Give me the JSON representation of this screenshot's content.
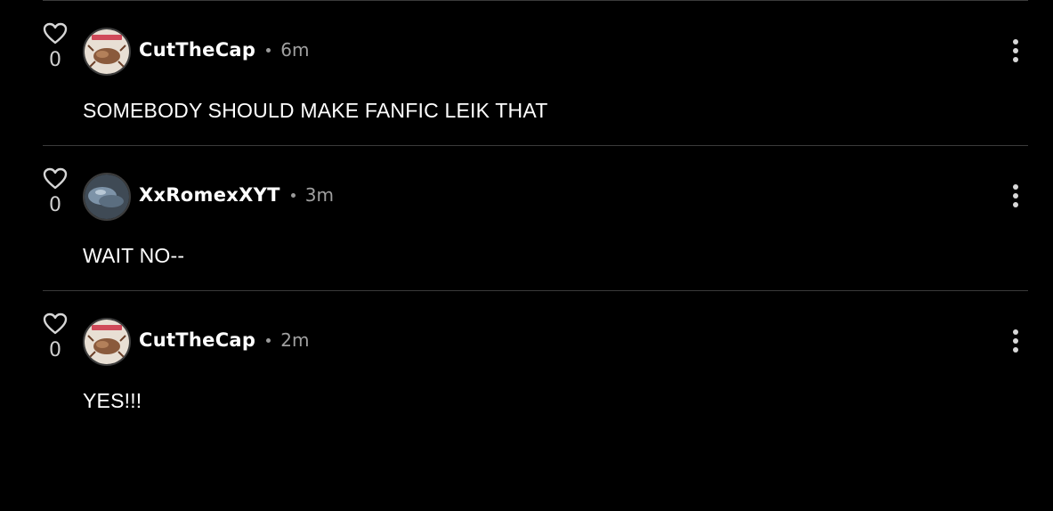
{
  "colors": {
    "background": "#000000",
    "divider": "#3a3a3a",
    "text_primary": "#ffffff",
    "text_muted": "#a0a0a0"
  },
  "comments": [
    {
      "username": "CutTheCap",
      "time": "6m",
      "likes": "0",
      "text": "SOMEBODY SHOULD MAKE FANFIC LEIK THAT",
      "avatar_icon": "slug-avatar-icon"
    },
    {
      "username": "XxRomexXYT",
      "time": "3m",
      "likes": "0",
      "text": "WAIT NO--",
      "avatar_icon": "blue-avatar-icon"
    },
    {
      "username": "CutTheCap",
      "time": "2m",
      "likes": "0",
      "text": "YES!!!",
      "avatar_icon": "slug-avatar-icon"
    }
  ],
  "icons": {
    "like": "heart-icon",
    "more": "more-vertical-icon"
  }
}
